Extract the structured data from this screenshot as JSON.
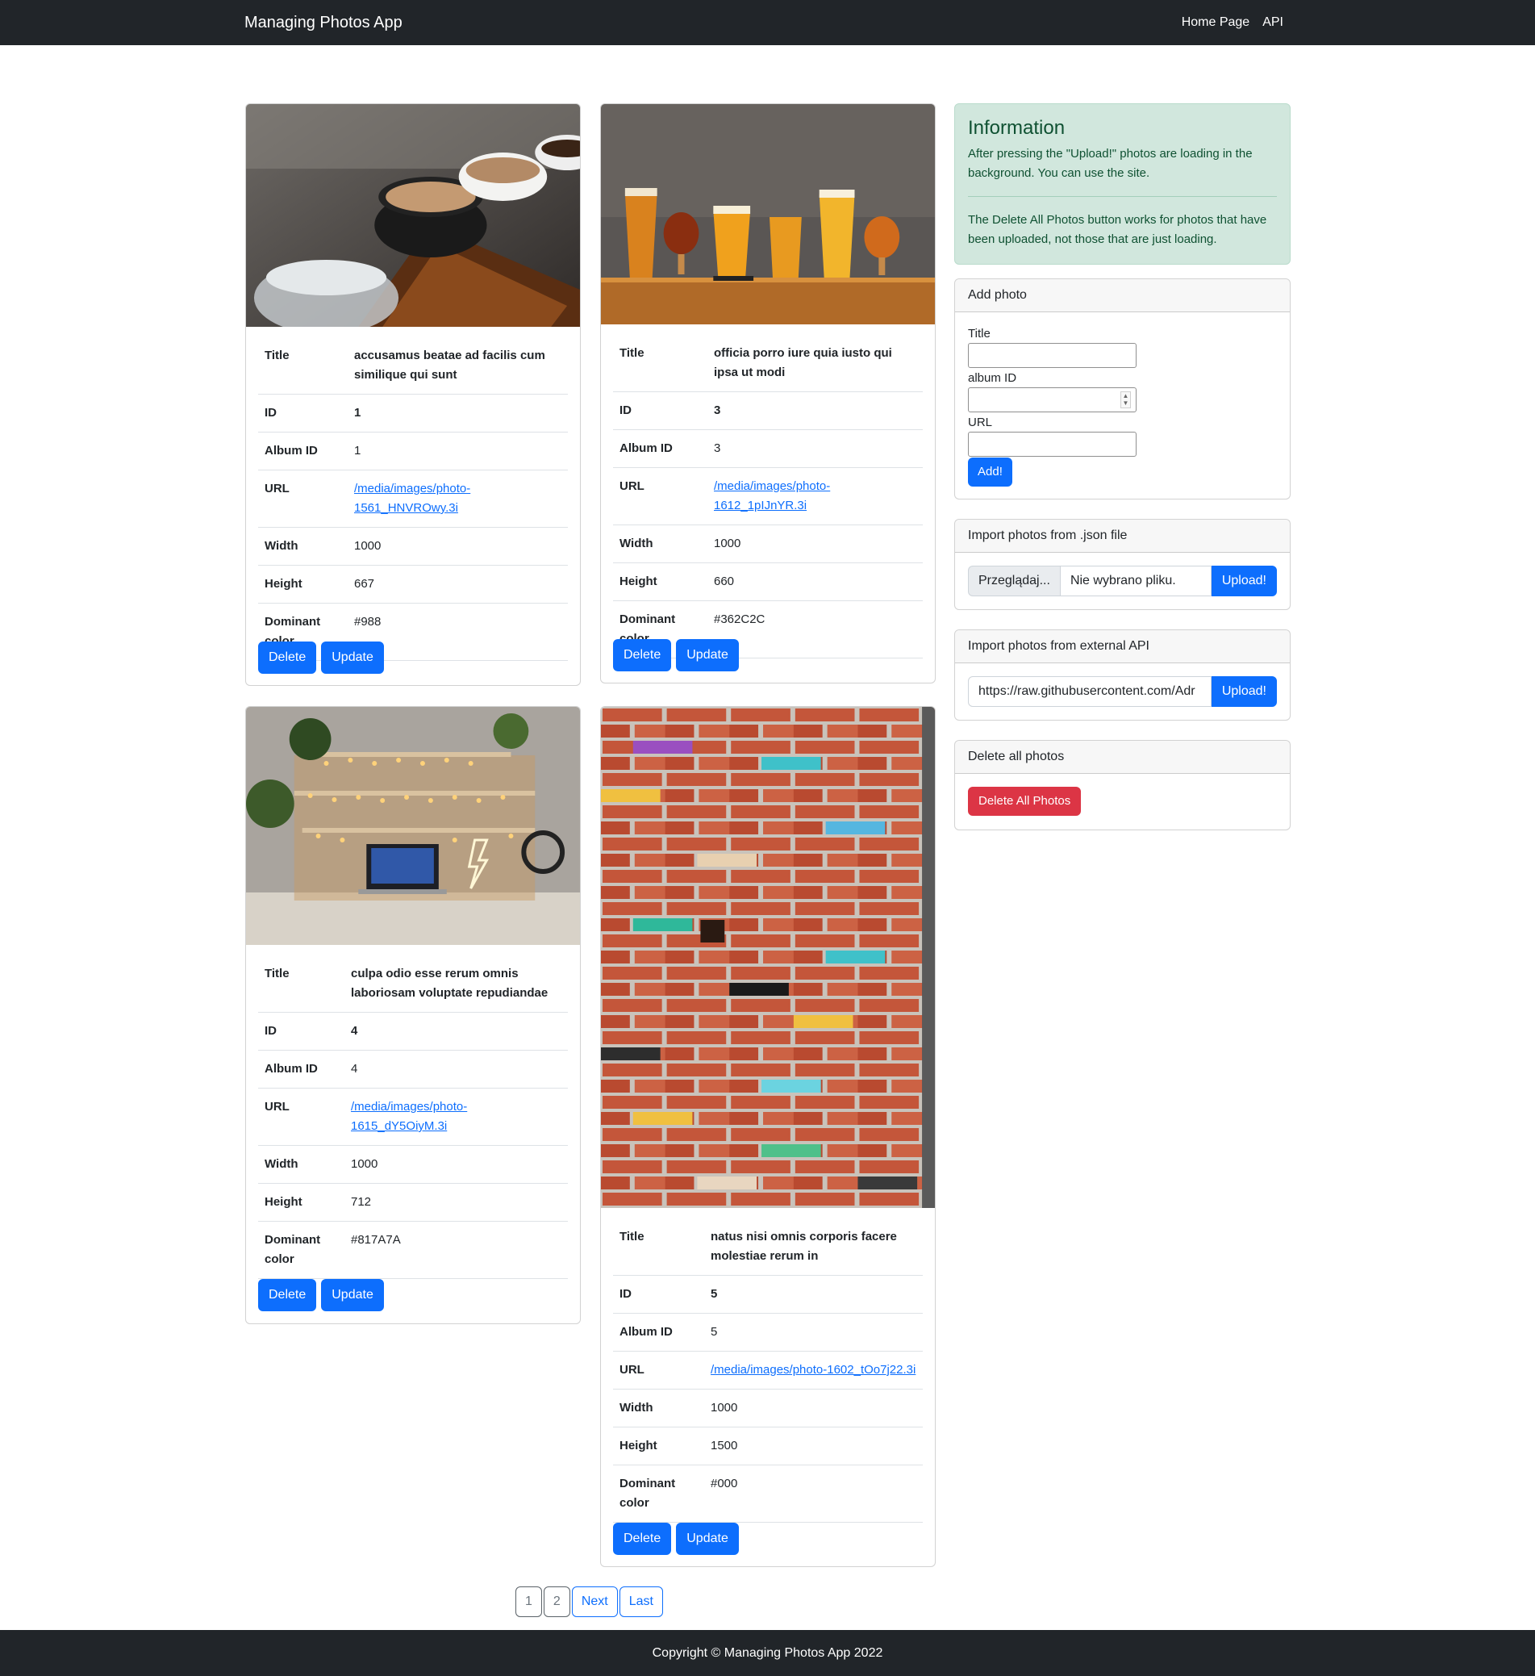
{
  "navbar": {
    "brand": "Managing Photos App",
    "links": [
      "Home Page",
      "API"
    ]
  },
  "labels": {
    "title": "Title",
    "id": "ID",
    "album_id": "Album ID",
    "url": "URL",
    "width": "Width",
    "height": "Height",
    "dominant_color": "Dominant color",
    "delete": "Delete",
    "update": "Update"
  },
  "photos": [
    {
      "title": "accusamus beatae ad facilis cum similique qui sunt",
      "id": "1",
      "album_id": "1",
      "url": "/media/images/photo-1561_HNVROwy.3i",
      "width": "1000",
      "height": "667",
      "dominant_color": "#988"
    },
    {
      "title": "officia porro iure quia iusto qui ipsa ut modi",
      "id": "3",
      "album_id": "3",
      "url": "/media/images/photo-1612_1pIJnYR.3i",
      "width": "1000",
      "height": "660",
      "dominant_color": "#362C2C"
    },
    {
      "title": "culpa odio esse rerum omnis laboriosam voluptate repudiandae",
      "id": "4",
      "album_id": "4",
      "url": "/media/images/photo-1615_dY5OiyM.3i",
      "width": "1000",
      "height": "712",
      "dominant_color": "#817A7A"
    },
    {
      "title": "natus nisi omnis corporis facere molestiae rerum in",
      "id": "5",
      "album_id": "5",
      "url": "/media/images/photo-1602_tOo7j22.3i",
      "width": "1000",
      "height": "1500",
      "dominant_color": "#000"
    }
  ],
  "info": {
    "heading": "Information",
    "text1": "After pressing the \"Upload!\" photos are loading in the background. You can use the site.",
    "text2": "The Delete All Photos button works for photos that have been uploaded, not those that are just loading."
  },
  "add_photo": {
    "header": "Add photo",
    "title_label": "Title",
    "album_label": "album ID",
    "url_label": "URL",
    "title_value": "",
    "album_value": "",
    "url_value": "",
    "submit": "Add!"
  },
  "import_json": {
    "header": "Import photos from .json file",
    "browse": "Przeglądaj...",
    "file_status": "Nie wybrano pliku.",
    "upload": "Upload!"
  },
  "import_api": {
    "header": "Import photos from external API",
    "url_value": "https://raw.githubusercontent.com/Adr",
    "upload": "Upload!"
  },
  "delete_all": {
    "header": "Delete all photos",
    "button": "Delete All Photos"
  },
  "pagination": [
    "1",
    "2",
    "Next",
    "Last"
  ],
  "footer": "Copyright © Managing Photos App 2022",
  "colors": {
    "navbar": "#212529",
    "primary": "#0d6efd",
    "danger": "#dc3545",
    "alert_bg": "#d1e7dd",
    "alert_text": "#0f5132"
  }
}
